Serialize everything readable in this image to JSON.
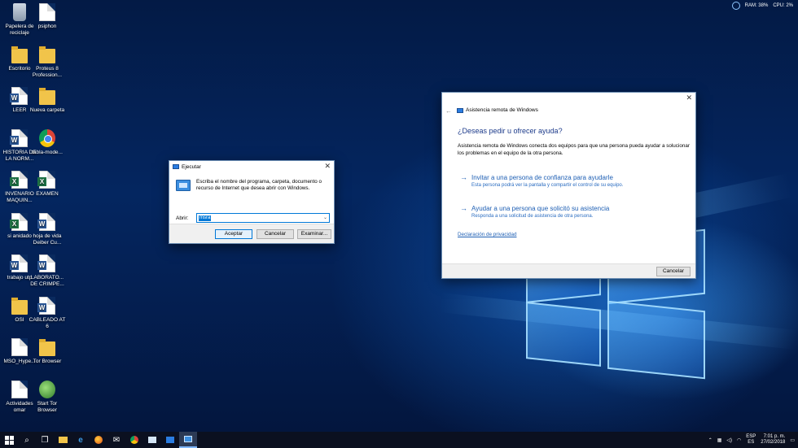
{
  "desktop": {
    "col1": [
      {
        "label": "Papelera de reciclaje",
        "icon": "recycle-bin-icon"
      },
      {
        "label": "Escritorio",
        "icon": "folder-icon"
      },
      {
        "label": "LEER",
        "icon": "word-doc-icon"
      },
      {
        "label": "HISTORIA DE LA NORM...",
        "icon": "word-doc-icon"
      },
      {
        "label": "INVENARIO MAQUIN...",
        "icon": "excel-doc-icon"
      },
      {
        "label": "si anidado",
        "icon": "excel-doc-icon"
      },
      {
        "label": "trabajo utp",
        "icon": "word-doc-icon"
      },
      {
        "label": "OSI",
        "icon": "folder-icon"
      },
      {
        "label": "MSO_Hype...",
        "icon": "file-icon"
      },
      {
        "label": "Actividades omar",
        "icon": "file-icon"
      }
    ],
    "col2": [
      {
        "label": "psiphon",
        "icon": "file-icon"
      },
      {
        "label": "Proteus 8 Profession...",
        "icon": "folder-icon"
      },
      {
        "label": "Nueva carpeta",
        "icon": "folder-icon"
      },
      {
        "label": "tabla-mode...",
        "icon": "chrome-icon"
      },
      {
        "label": "EXAMEN",
        "icon": "excel-doc-icon"
      },
      {
        "label": "hoja de vida Deiber Cu...",
        "icon": "word-doc-icon"
      },
      {
        "label": "LABORATO... DE CRIMPE...",
        "icon": "word-doc-icon"
      },
      {
        "label": "CABLEADO AT 6",
        "icon": "word-doc-icon"
      },
      {
        "label": "Tor Browser",
        "icon": "folder-icon"
      },
      {
        "label": "Start Tor Browser",
        "icon": "globe-icon"
      }
    ]
  },
  "sysmon": {
    "ram": "RAM: 38%",
    "cpu": "CPU: 2%"
  },
  "run": {
    "title": "Ejecutar",
    "description": "Escriba el nombre del programa, carpeta, documento o recurso de Internet que desea abrir con Windows.",
    "open_label": "Abrir:",
    "open_value": "msra",
    "accept": "Aceptar",
    "cancel": "Cancelar",
    "browse": "Examinar..."
  },
  "remote": {
    "title": "Asistencia remota de Windows",
    "question": "¿Deseas pedir u ofrecer ayuda?",
    "description": "Asistencia remota de Windows conecta dos equipos para que una persona pueda ayudar a solucionar los problemas en el equipo de la otra persona.",
    "option1_title": "Invitar a una persona de confianza para ayudarle",
    "option1_sub": "Esta persona podrá ver la pantalla y compartir el control de su equipo.",
    "option2_title": "Ayudar a una persona que solicitó su asistencia",
    "option2_sub": "Responda a una solicitud de asistencia de otra persona.",
    "privacy": "Declaración de privacidad",
    "cancel": "Cancelar"
  },
  "taskbar": {
    "lang1": "ESP",
    "lang2": "ES",
    "time": "7:01 p. m.",
    "date": "27/02/2018"
  }
}
